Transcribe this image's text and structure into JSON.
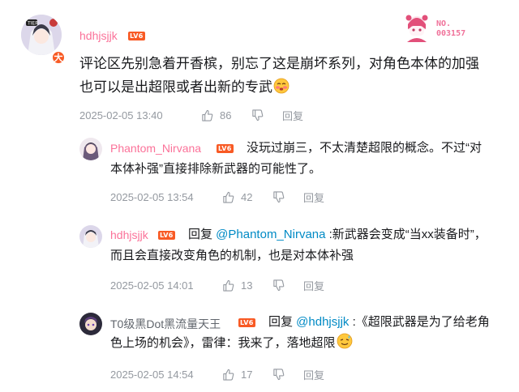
{
  "badge": {
    "no_label": "NO.",
    "number": "003157"
  },
  "comments": [
    {
      "username": "hdhjsjjk",
      "level": "LV6",
      "text": "评论区先别急着开香槟，别忘了这是崩坏系列，对角色本体的加强也可以是出超限或者出新的专武",
      "time": "2025-02-05 13:40",
      "likes": "86",
      "reply_label": "回复",
      "avatar_badge": "大"
    },
    {
      "username": "Phantom_Nirvana",
      "level": "LV6",
      "text": "没玩过崩三，不太清楚超限的概念。不过“对本体补强”直接排除新武器的可能性了。",
      "time": "2025-02-05 13:54",
      "likes": "42",
      "reply_label": "回复"
    },
    {
      "username": "hdhjsjjk",
      "level": "LV6",
      "reply_prefix": "回复 ",
      "mention": "@Phantom_Nirvana",
      "text": " :新武器会变成“当xx装备时”，而且会直接改变角色的机制，也是对本体补强",
      "time": "2025-02-05 14:01",
      "likes": "13",
      "reply_label": "回复"
    },
    {
      "username": "T0级黑Dot黑流量天王",
      "level": "LV6",
      "reply_prefix": "回复 ",
      "mention": "@hdhjsjjk",
      "text": " :《超限武器是为了给老角色上场的机会》，雷律：我来了，落地超限",
      "time": "2025-02-05 14:54",
      "likes": "17",
      "reply_label": "回复"
    }
  ],
  "colors": {
    "pink": "#fb7299",
    "mention": "#008ac5",
    "level": "#f85a24",
    "meta": "#9499a0"
  },
  "icons": {
    "like": "thumb-up-icon",
    "dislike": "thumb-down-icon",
    "emoji1": "shy-face-emoji",
    "emoji2": "sweat-face-emoji"
  }
}
